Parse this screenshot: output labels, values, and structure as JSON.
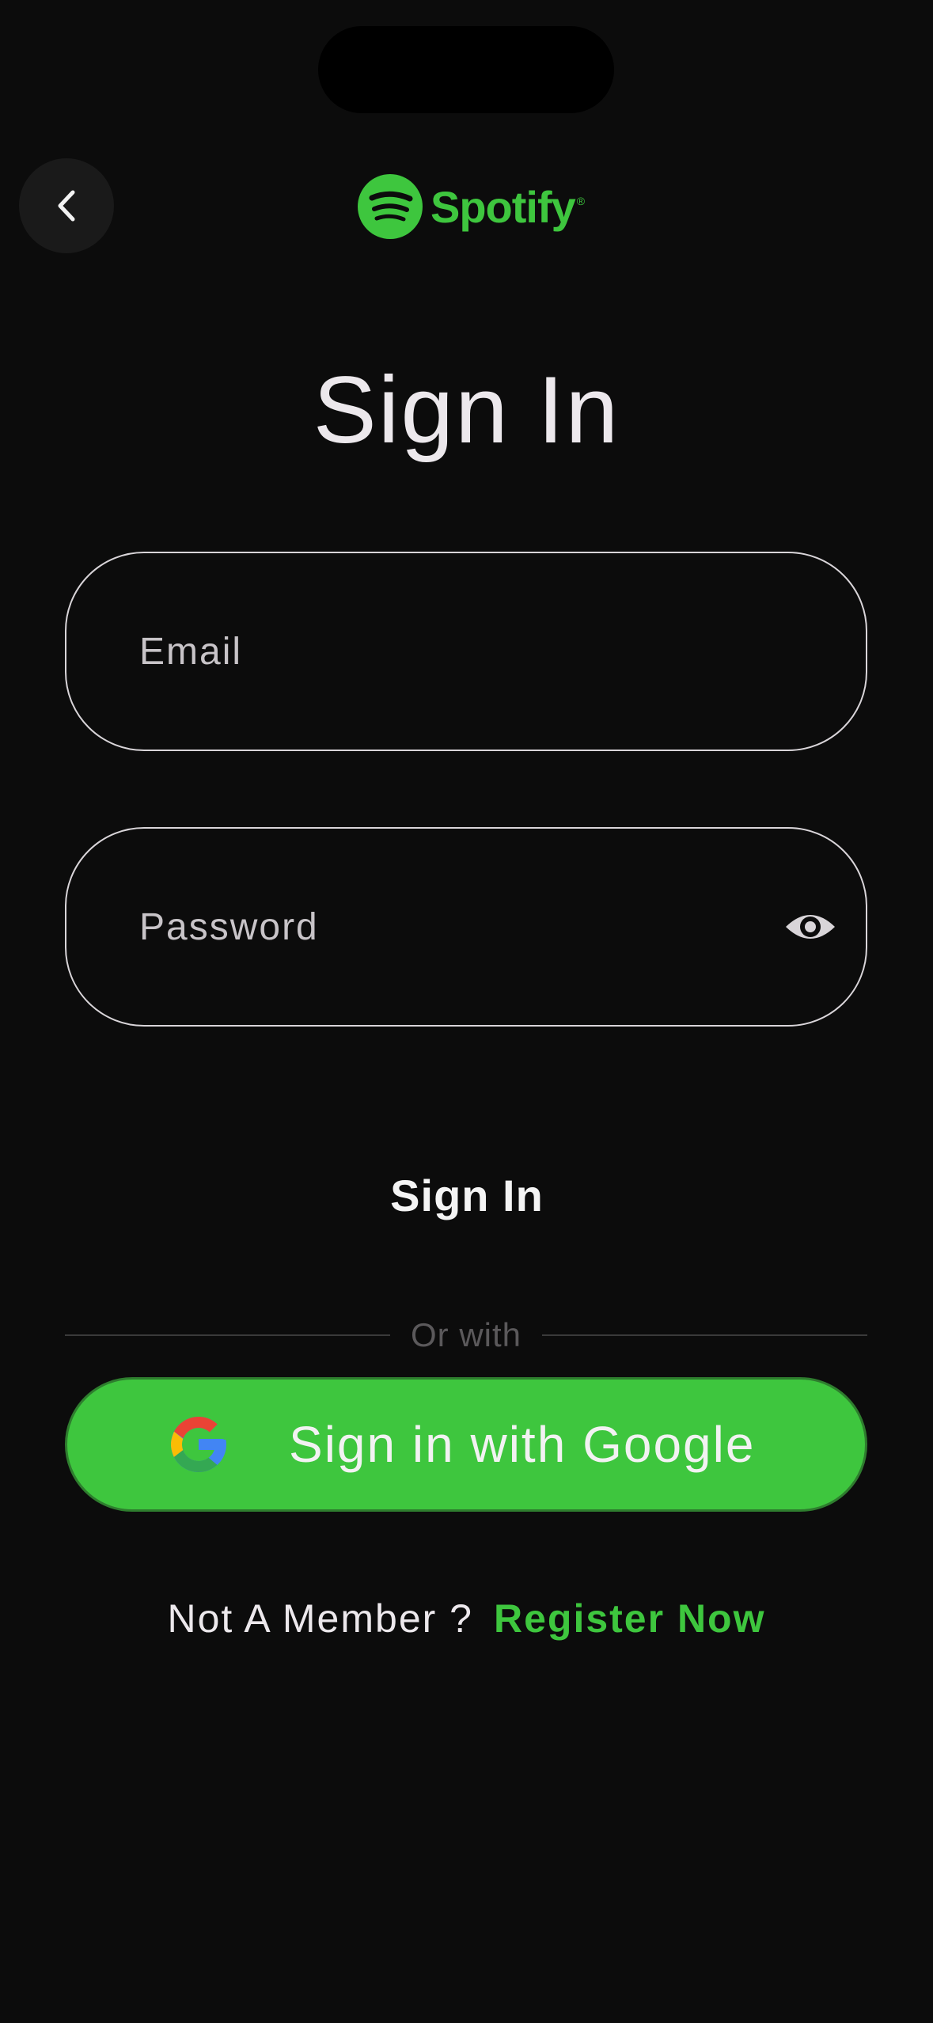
{
  "header": {
    "back_icon": "chevron-left-icon",
    "logo_text": "Spotify",
    "logo_reg": "®",
    "brand_color": "#3ec63e"
  },
  "main": {
    "title": "Sign In",
    "email": {
      "placeholder": "Email",
      "value": ""
    },
    "password": {
      "placeholder": "Password",
      "value": "",
      "toggle_icon": "eye-icon"
    },
    "signin_label": "Sign In",
    "divider_text": "Or with",
    "google_label": "Sign in with Google",
    "google_icon": "google-icon",
    "footer": {
      "question": "Not A Member ?",
      "register_label": "Register Now"
    }
  }
}
